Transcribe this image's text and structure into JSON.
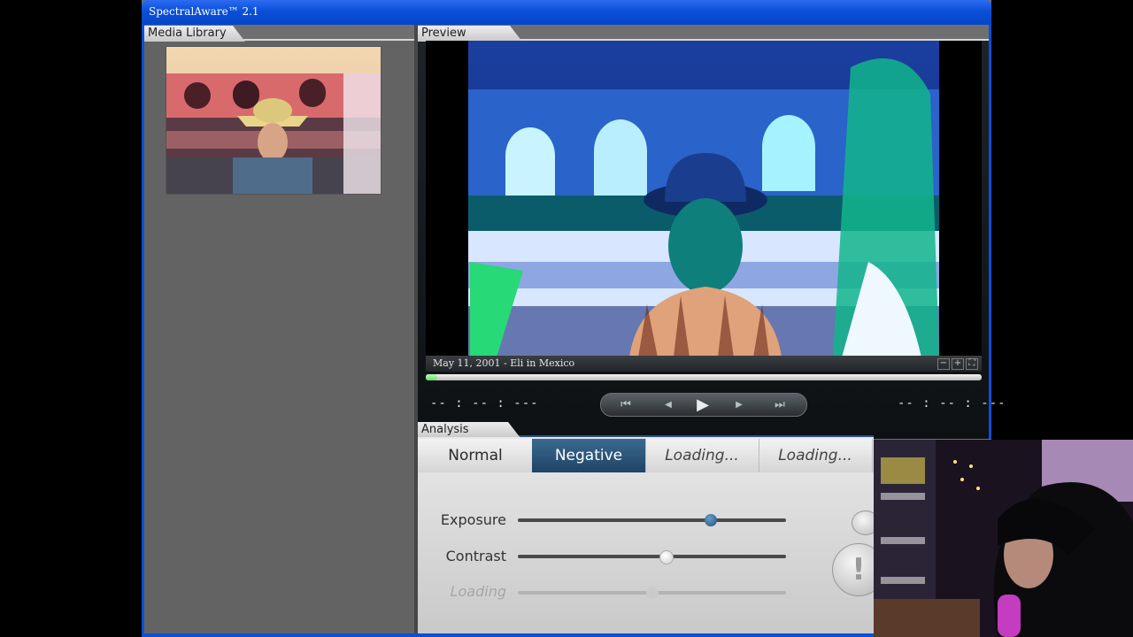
{
  "window": {
    "title": "SpectralAware™ 2.1"
  },
  "media_library": {
    "tab_label": "Media Library",
    "thumbnail": {
      "description_icon": "photo-thumbnail-icon"
    }
  },
  "preview": {
    "tab_label": "Preview",
    "caption": "May 11, 2001 - Eli in Mexico",
    "progress": 0.02,
    "time_left": "-- : -- : ---",
    "time_right": "-- : -- : ---",
    "transport": {
      "skip_back": "⏮",
      "step_back": "◀",
      "play": "▶",
      "step_forward": "▶",
      "skip_forward": "⏭"
    },
    "zoom": {
      "minus": "−",
      "plus": "+",
      "fit": "⛶"
    }
  },
  "analysis": {
    "tab_label": "Analysis",
    "modes": [
      {
        "label": "Normal",
        "active": false,
        "loading": false
      },
      {
        "label": "Negative",
        "active": true,
        "loading": false
      },
      {
        "label": "Loading...",
        "active": false,
        "loading": true
      },
      {
        "label": "Loading...",
        "active": false,
        "loading": true
      }
    ],
    "sliders": [
      {
        "label": "Exposure",
        "value": 0.72,
        "enabled": true
      },
      {
        "label": "Contrast",
        "value": 0.55,
        "enabled": true
      },
      {
        "label": "Loading",
        "value": 0.5,
        "enabled": false
      }
    ],
    "warning_symbol": "!"
  },
  "colors": {
    "titlebar": "#0a4fd8",
    "active_mode": "#1e4466",
    "progress": "#6fd86f"
  }
}
